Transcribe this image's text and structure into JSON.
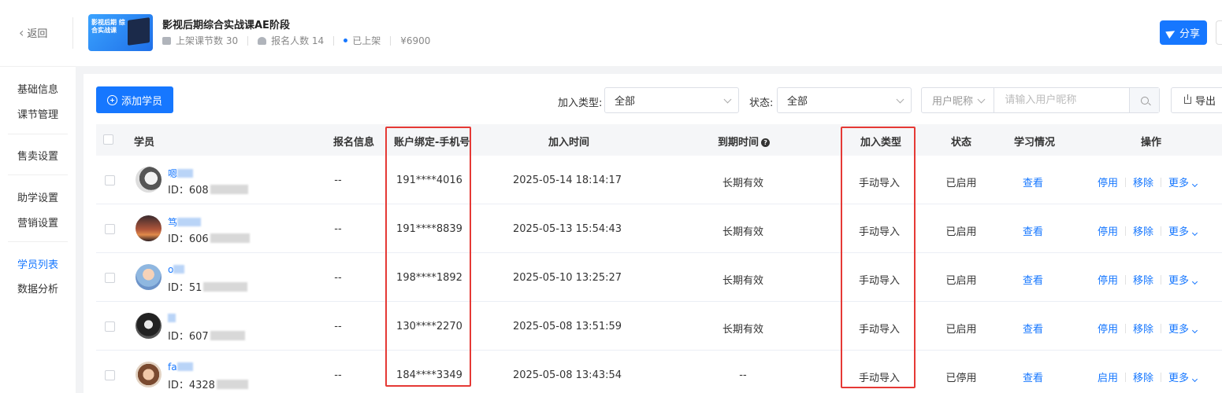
{
  "header": {
    "back_label": "返回",
    "cover_text": "影视后期 综合实战课",
    "course_title": "影视后期综合实战课AE阶段",
    "lessons": "上架课节数 30",
    "enrolled": "报名人数 14",
    "status": "已上架",
    "price": "¥6900",
    "share_label": "分享",
    "accent_color": "#1677ff"
  },
  "sidebar": {
    "items": [
      {
        "label": "基础信息"
      },
      {
        "label": "课节管理"
      },
      {
        "label": "售卖设置"
      },
      {
        "label": "助学设置"
      },
      {
        "label": "营销设置"
      },
      {
        "label": "学员列表"
      },
      {
        "label": "数据分析"
      }
    ],
    "active": "学员列表"
  },
  "toolbar": {
    "add_label": "添加学员",
    "join_type_label": "加入类型:",
    "join_type_value": "全部",
    "status_label": "状态:",
    "status_value": "全部",
    "search_type": "用户昵称",
    "search_placeholder": "请输入用户昵称",
    "export_label": "导出"
  },
  "table": {
    "columns": [
      "学员",
      "报名信息",
      "账户绑定-手机号",
      "加入时间",
      "到期时间",
      "加入类型",
      "状态",
      "学习情况",
      "操作"
    ],
    "rows": [
      {
        "name": "嗯",
        "id": "ID：608",
        "signup": "--",
        "phone": "191****4016",
        "join_time": "2025-05-14 18:14:17",
        "expire": "长期有效",
        "join_type": "手动导入",
        "status": "已启用",
        "study": "查看",
        "op1": "停用",
        "op2": "移除",
        "op3": "更多"
      },
      {
        "name": "笃",
        "id": "ID：606",
        "signup": "--",
        "phone": "191****8839",
        "join_time": "2025-05-13 15:54:43",
        "expire": "长期有效",
        "join_type": "手动导入",
        "status": "已启用",
        "study": "查看",
        "op1": "停用",
        "op2": "移除",
        "op3": "更多"
      },
      {
        "name": "o",
        "id": "ID：51",
        "signup": "--",
        "phone": "198****1892",
        "join_time": "2025-05-10 13:25:27",
        "expire": "长期有效",
        "join_type": "手动导入",
        "status": "已启用",
        "study": "查看",
        "op1": "停用",
        "op2": "移除",
        "op3": "更多"
      },
      {
        "name": "",
        "id": "ID：607",
        "signup": "--",
        "phone": "130****2270",
        "join_time": "2025-05-08 13:51:59",
        "expire": "长期有效",
        "join_type": "手动导入",
        "status": "已启用",
        "study": "查看",
        "op1": "停用",
        "op2": "移除",
        "op3": "更多"
      },
      {
        "name": "fa",
        "id": "ID：4328",
        "signup": "--",
        "phone": "184****3349",
        "join_time": "2025-05-08 13:43:54",
        "expire": "--",
        "join_type": "手动导入",
        "status": "已停用",
        "study": "查看",
        "op1": "启用",
        "op2": "移除",
        "op3": "更多"
      }
    ]
  },
  "highlight_color": "#e53935"
}
